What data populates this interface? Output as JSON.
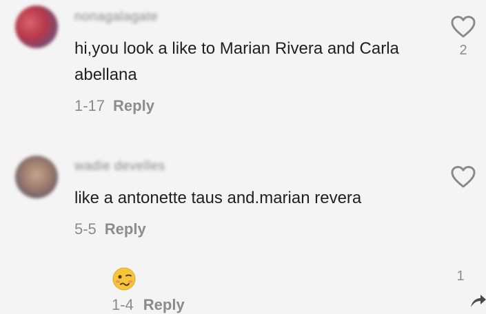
{
  "comments": [
    {
      "username": "nonagalagate",
      "text": "hi,you look a like to Marian Rivera and Carla abellana",
      "date": "1-17",
      "reply_label": "Reply",
      "like_count": "2"
    },
    {
      "username": "wadie develles",
      "text": "like a antonette taus and.marian revera",
      "date": "5-5",
      "reply_label": "Reply",
      "like_count": ""
    }
  ],
  "reply": {
    "emoji": "woozy-face",
    "date": "1-4",
    "reply_label": "Reply",
    "like_count": "1"
  },
  "icons": {
    "like": "heart-outline-icon",
    "share": "share-arrow-icon"
  },
  "colors": {
    "background": "#f4f4f4",
    "text": "#1f1f1f",
    "muted": "#8a8a8a"
  }
}
